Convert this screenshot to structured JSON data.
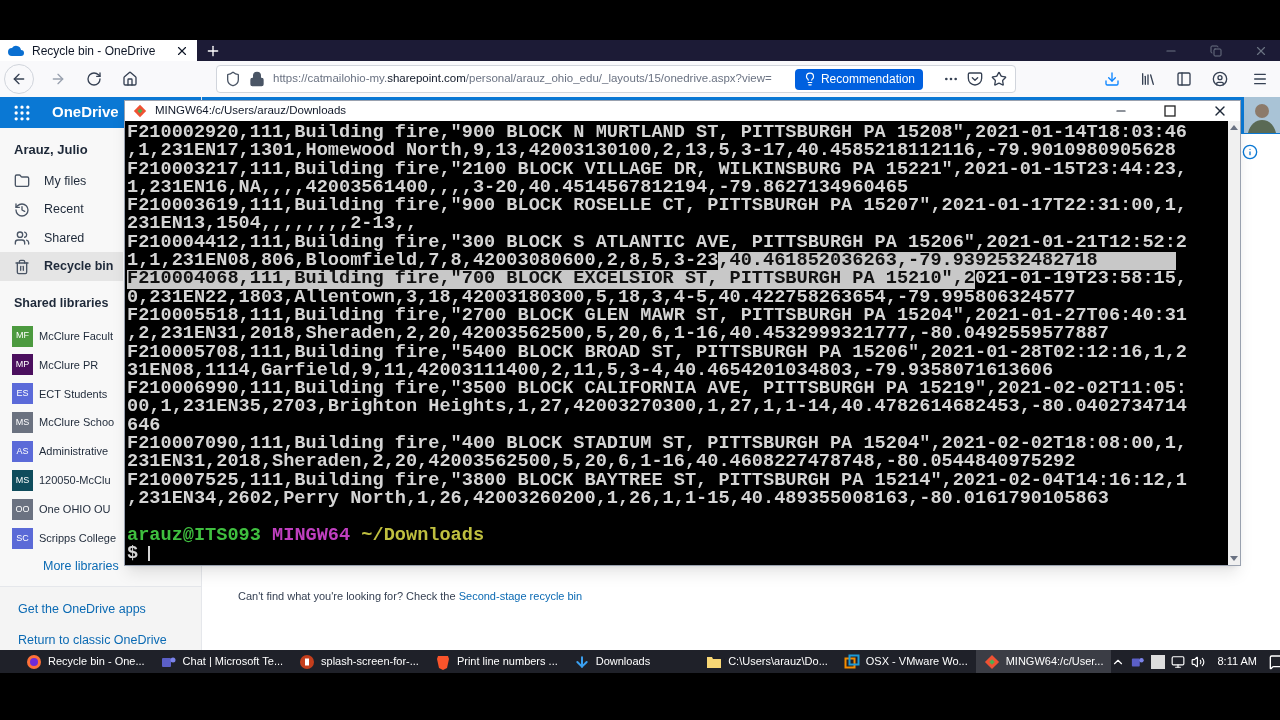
{
  "browser": {
    "tab": {
      "title": "Recycle bin - OneDrive",
      "selected": true
    },
    "url": {
      "prefix": "https://catmailohio-my.",
      "domain": "sharepoint.com",
      "path": "/personal/arauz_ohio_edu/_layouts/15/onedrive.aspx?view="
    },
    "recommendation": "Recommendation"
  },
  "onedrive": {
    "app_name": "OneDrive",
    "user": "Arauz, Julio",
    "nav": [
      {
        "label": "My files",
        "kind": "folder",
        "selected": false
      },
      {
        "label": "Recent",
        "kind": "clock",
        "selected": false
      },
      {
        "label": "Shared",
        "kind": "people",
        "selected": false
      },
      {
        "label": "Recycle bin",
        "kind": "trash",
        "selected": true
      }
    ],
    "shared_libraries_heading": "Shared libraries",
    "libraries": [
      {
        "initials": "MF",
        "name": "McClure Facult",
        "color": "#4c9a3f"
      },
      {
        "initials": "MP",
        "name": "McClure PR",
        "color": "#4b0f5e"
      },
      {
        "initials": "ES",
        "name": "ECT Students",
        "color": "#5b6ad9"
      },
      {
        "initials": "MS",
        "name": "McClure Schoo",
        "color": "#6b7280"
      },
      {
        "initials": "AS",
        "name": "Administrative",
        "color": "#5b6ad8"
      },
      {
        "initials": "MS",
        "name": "120050-McClu",
        "color": "#0f4c5c"
      },
      {
        "initials": "OO",
        "name": "One OHIO OU",
        "color": "#6b7281"
      },
      {
        "initials": "SC",
        "name": "Scripps College",
        "color": "#5b6ad7"
      }
    ],
    "more_libraries": "More libraries",
    "get_apps": "Get the OneDrive apps",
    "return_classic": "Return to classic OneDrive",
    "empty_message": {
      "text": "Can't find what you're looking for? Check the",
      "link": "Second-stage recycle bin"
    }
  },
  "terminal": {
    "title": "MINGW64:/c/Users/arauz/Downloads",
    "lines": [
      [
        {
          "text": "F210002920,111,Building fire,\"900 BLOCK N MURTLAND ST, PITTSBURGH PA 15208\",2021-01-14T18:03:46",
          "selected": false
        }
      ],
      [
        {
          "text": ",1,231EN17,1301,Homewood North,9,13,42003130100,2,13,5,3-17,40.4585218112116,-79.9010980905628",
          "selected": false
        }
      ],
      [
        {
          "text": "F210003217,111,Building fire,\"2100 BLOCK VILLAGE DR, WILKINSBURG PA 15221\",2021-01-15T23:44:23,",
          "selected": false
        }
      ],
      [
        {
          "text": "1,231EN16,NA,,,,42003561400,,,,3-20,40.4514567812194,-79.8627134960465",
          "selected": false
        }
      ],
      [
        {
          "text": "F210003619,111,Building fire,\"900 BLOCK ROSELLE CT, PITTSBURGH PA 15207\",2021-01-17T22:31:00,1,",
          "selected": false
        }
      ],
      [
        {
          "text": "231EN13,1504,,,,,,,,2-13,,",
          "selected": false
        }
      ],
      [
        {
          "text": "F210004412,111,Building fire,\"300 BLOCK S ATLANTIC AVE, PITTSBURGH PA 15206\",2021-01-21T12:52:2",
          "selected": false
        }
      ],
      [
        {
          "text": "1,1,231EN08,806,Bloomfield,7,8,42003080600,2,8,5,3-23",
          "selected": false
        },
        {
          "text": ",40.461852036263,-79.9392532482718       ",
          "selected": true
        }
      ],
      [
        {
          "text": "F210004068,111,Building fire,\"700 BLOCK EXCELSIOR ST, PITTSBURGH PA 15210\",2",
          "selected": true
        },
        {
          "text": "021-01-19T23:58:15,",
          "selected": false
        }
      ],
      [
        {
          "text": "0,231EN22,1803,Allentown,3,18,42003180300,5,18,3,4-5,40.422758263654,-79.995806324577",
          "selected": false
        }
      ],
      [
        {
          "text": "F210005518,111,Building fire,\"2700 BLOCK GLEN MAWR ST, PITTSBURGH PA 15204\",2021-01-27T06:40:31",
          "selected": false
        }
      ],
      [
        {
          "text": ",2,231EN31,2018,Sheraden,2,20,42003562500,5,20,6,1-16,40.4532999321777,-80.0492559577887",
          "selected": false
        }
      ],
      [
        {
          "text": "F210005708,111,Building fire,\"5400 BLOCK BROAD ST, PITTSBURGH PA 15206\",2021-01-28T02:12:16,1,2",
          "selected": false
        }
      ],
      [
        {
          "text": "31EN08,1114,Garfield,9,11,42003111400,2,11,5,3-4,40.4654201034803,-79.9358071613606",
          "selected": false
        }
      ],
      [
        {
          "text": "F210006990,111,Building fire,\"3500 BLOCK CALIFORNIA AVE, PITTSBURGH PA 15219\",2021-02-02T11:05:",
          "selected": false
        }
      ],
      [
        {
          "text": "00,1,231EN35,2703,Brighton Heights,1,27,42003270300,1,27,1,1-14,40.4782614682453,-80.0402734714",
          "selected": false
        }
      ],
      [
        {
          "text": "646",
          "selected": false
        }
      ],
      [
        {
          "text": "F210007090,111,Building fire,\"400 BLOCK STADIUM ST, PITTSBURGH PA 15204\",2021-02-02T18:08:00,1,",
          "selected": false
        }
      ],
      [
        {
          "text": "231EN31,2018,Sheraden,2,20,42003562500,5,20,6,1-16,40.4608227478748,-80.0544840975292",
          "selected": false
        }
      ],
      [
        {
          "text": "F210007525,111,Building fire,\"3800 BLOCK BAYTREE ST, PITTSBURGH PA 15214\",2021-02-04T14:16:12,1",
          "selected": false
        }
      ],
      [
        {
          "text": ",231EN34,2602,Perry North,1,26,42003260200,1,26,1,1-15,40.489355008163,-80.0161790105863",
          "selected": false
        }
      ]
    ],
    "prompt": {
      "user": "arauz@ITS093",
      "shell": "MINGW64",
      "path": "~/Downloads",
      "symbol": "$"
    }
  },
  "taskbar": {
    "items": [
      {
        "label": "Recycle bin - One...",
        "kind": "firefox",
        "selected": false
      },
      {
        "label": "Chat | Microsoft Te...",
        "kind": "teams",
        "selected": false
      },
      {
        "label": "splash-screen-for-...",
        "kind": "powerpoint",
        "selected": false
      },
      {
        "label": "Print line numbers ...",
        "kind": "brave",
        "selected": false
      },
      {
        "label": "Downloads",
        "kind": "download",
        "selected": false
      },
      {
        "label": "C:\\Users\\arauz\\Do...",
        "kind": "folder",
        "selected": false
      },
      {
        "label": "OSX - VMware Wo...",
        "kind": "vmware",
        "selected": false
      },
      {
        "label": "MINGW64:/c/User...",
        "kind": "git",
        "selected": true
      }
    ],
    "clock": "8:11 AM"
  }
}
